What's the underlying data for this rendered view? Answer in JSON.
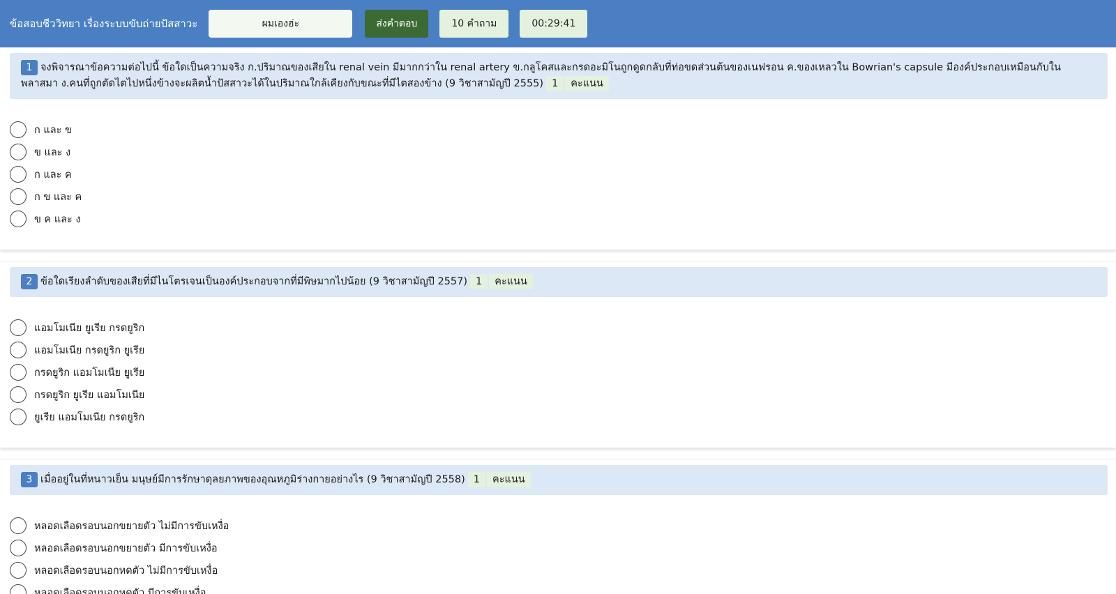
{
  "header": {
    "title": "ข้อสอบชีววิทยา เรื่องระบบขับถ่ายปัสสาวะ",
    "name_value": "ผมเองฮ่ะ",
    "submit_label": "ส่งคำตอบ",
    "question_count": "10 คำถาม",
    "timer": "00:29:41"
  },
  "points_label": "คะแนน",
  "questions": [
    {
      "number": "1",
      "text": "จงพิจารณาข้อความต่อไปนี้ ข้อใดเป็นความจริง ก.ปริมาณของเสียใน renal vein มีมากกว่าใน renal artery ข.กลูโคสและกรดอะมิโนถูกดูดกลับที่ท่อขดส่วนต้นของเนฟรอน ค.ของเหลวใน Bowrian's capsule มีองค์ประกอบเหมือนกับในพลาสมา ง.คนที่ถูกตัดไตไปหนึ่งข้างจะผลิตน้ำปัสสาวะได้ในปริมาณใกล้เคียงกับขณะที่มีไตสองข้าง (9 วิชาสามัญปี 2555)",
      "points": "1",
      "options": [
        "ก และ ข",
        "ข และ ง",
        "ก และ ค",
        "ก ข และ ค",
        "ข ค และ ง"
      ]
    },
    {
      "number": "2",
      "text": "ข้อใดเรียงลำดับของเสียที่มีไนโตรเจนเป็นองค์ประกอบจากที่มีพิษมากไปน้อย (9 วิชาสามัญปี 2557)",
      "points": "1",
      "options": [
        "แอมโมเนีย ยูเรีย กรดยูริก",
        "แอมโมเนีย กรดยูริก ยูเรีย",
        "กรดยูริก แอมโมเนีย ยูเรีย",
        "กรดยูริก ยูเรีย แอมโมเนีย",
        "ยูเรีย แอมโมเนีย กรดยูริก"
      ]
    },
    {
      "number": "3",
      "text": "เมื่ออยู่ในที่หนาวเย็น มนุษย์มีการรักษาดุลยภาพของอุณหภูมิร่างกายอย่างไร (9 วิชาสามัญปี 2558)",
      "points": "1",
      "options": [
        "หลอดเลือดรอบนอกขยายตัว ไม่มีการขับเหงื่อ",
        "หลอดเลือดรอบนอกขยายตัว มีการขับเหงื่อ",
        "หลอดเลือดรอบนอกหดตัว ไม่มีการขับเหงื่อ",
        "หลอดเลือดรอบนอกหดตัว มีการขับเหงื่อ"
      ]
    }
  ]
}
